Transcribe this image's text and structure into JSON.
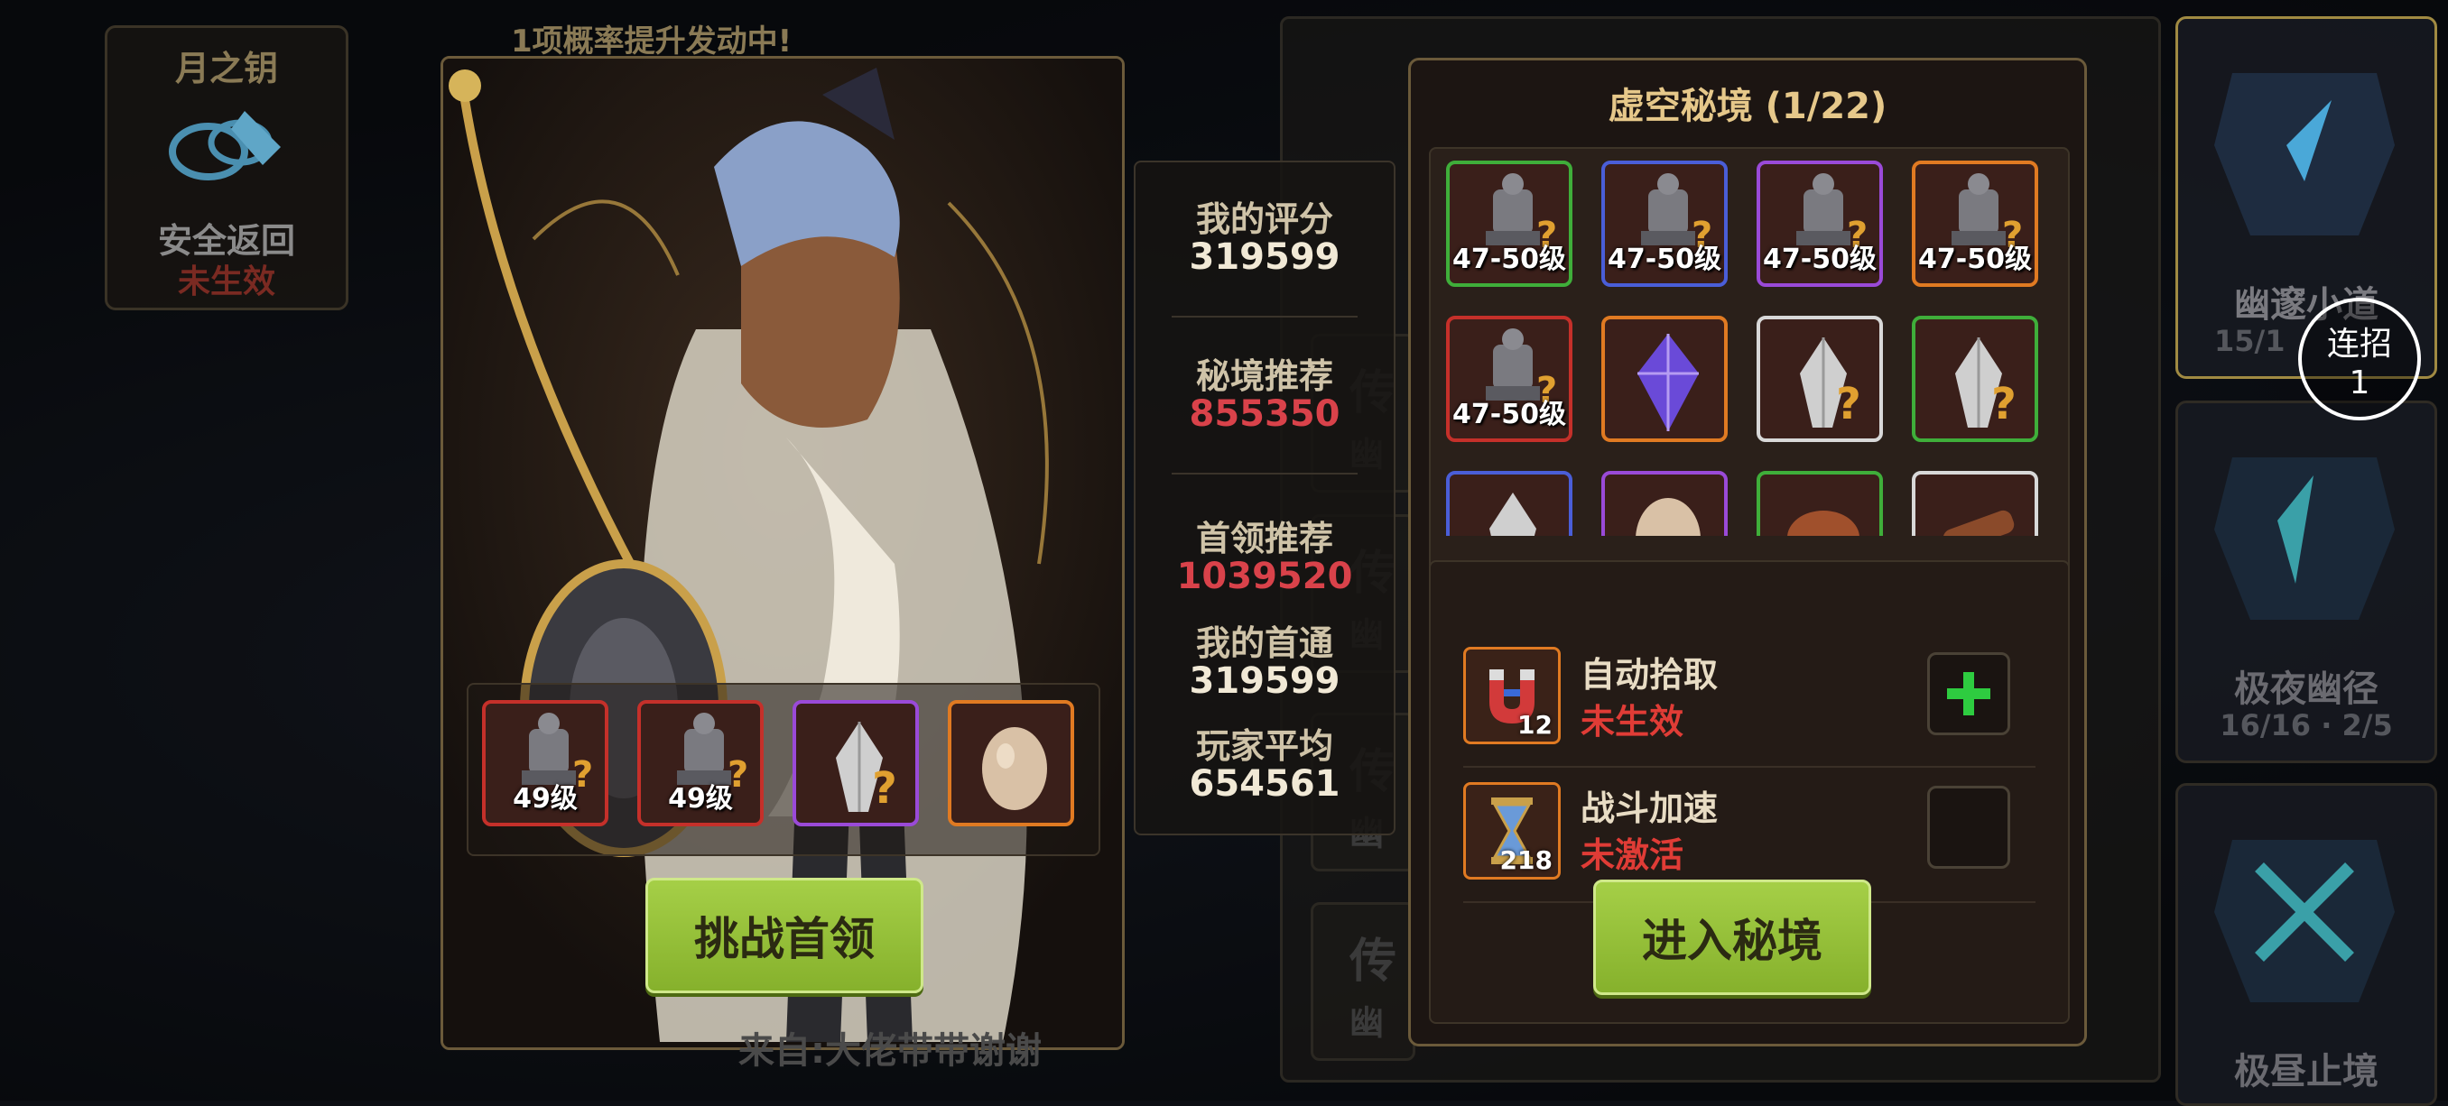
{
  "moon_key": {
    "title": "月之钥",
    "subtitle": "安全返回",
    "status": "未生效"
  },
  "banner": "1项概率提升发动中!",
  "boss": {
    "loot": [
      {
        "label": "49级",
        "rarity": "red",
        "icon": "armor-icon"
      },
      {
        "label": "49级",
        "rarity": "red",
        "icon": "armor-icon"
      },
      {
        "label": "",
        "rarity": "purple",
        "icon": "mystery-crystal-icon"
      },
      {
        "label": "",
        "rarity": "orange",
        "icon": "egg-icon"
      }
    ],
    "challenge_label": "挑战首领"
  },
  "stats": {
    "my_score_label": "我的评分",
    "my_score": "319599",
    "realm_rec_label": "秘境推荐",
    "realm_rec": "855350",
    "boss_rec_label": "首领推荐",
    "boss_rec": "1039520",
    "my_first_label": "我的首通",
    "my_first": "319599",
    "player_avg_label": "玩家平均",
    "player_avg": "654561"
  },
  "background_panels": {
    "label_fragment": "传",
    "sub_fragment": "幽"
  },
  "realm": {
    "title": "虚空秘境 (1/22)",
    "grid": [
      {
        "label": "47-50级",
        "rarity": "green",
        "icon": "armor-icon"
      },
      {
        "label": "47-50级",
        "rarity": "blue",
        "icon": "armor-icon"
      },
      {
        "label": "47-50级",
        "rarity": "purple",
        "icon": "armor-icon"
      },
      {
        "label": "47-50级",
        "rarity": "orange",
        "icon": "armor-icon"
      },
      {
        "label": "47-50级",
        "rarity": "red",
        "icon": "armor-icon"
      },
      {
        "label": "",
        "rarity": "orange",
        "icon": "purple-gem-icon"
      },
      {
        "label": "",
        "rarity": "white",
        "icon": "mystery-crystal-icon"
      },
      {
        "label": "",
        "rarity": "green",
        "icon": "mystery-crystal-icon"
      },
      {
        "label": "",
        "rarity": "blue",
        "icon": "mystery-crystal-icon"
      },
      {
        "label": "",
        "rarity": "purple",
        "icon": "egg-icon"
      },
      {
        "label": "",
        "rarity": "green",
        "icon": "meat-icon"
      },
      {
        "label": "",
        "rarity": "white",
        "icon": "wood-icon"
      }
    ],
    "options": [
      {
        "name": "自动拾取",
        "status": "未生效",
        "count": "12",
        "icon": "magnet-icon",
        "toggle": "plus-icon"
      },
      {
        "name": "战斗加速",
        "status": "未激活",
        "count": "218",
        "icon": "hourglass-icon",
        "toggle": ""
      }
    ],
    "enter_label": "进入秘境"
  },
  "right_column": [
    {
      "name": "幽邃小道",
      "progress": "15/1"
    },
    {
      "name": "极夜幽径",
      "progress": "16/16 · 2/5"
    },
    {
      "name": "极昼止境",
      "progress": ""
    }
  ],
  "combo": {
    "label": "连招",
    "count": "1"
  },
  "bottom_note": "来自:大佬带带谢谢",
  "colors": {
    "accent_gold": "#e6c88a",
    "button_green": "#9cc43e",
    "status_red": "#e03c36"
  }
}
